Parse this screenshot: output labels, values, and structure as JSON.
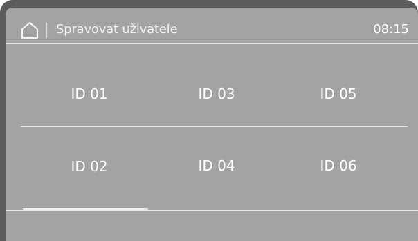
{
  "header": {
    "home_icon": "home-icon",
    "title": "Spravovat uživatele",
    "time": "08:15"
  },
  "users": {
    "row1": [
      "ID 01",
      "ID 03",
      "ID 05"
    ],
    "row2": [
      "ID 02",
      "ID 04",
      "ID 06"
    ]
  },
  "colors": {
    "bezel": "#5c5c5c",
    "screen": "#a3a3a3",
    "text": "#ffffff",
    "divider": "#e6e6e6"
  }
}
